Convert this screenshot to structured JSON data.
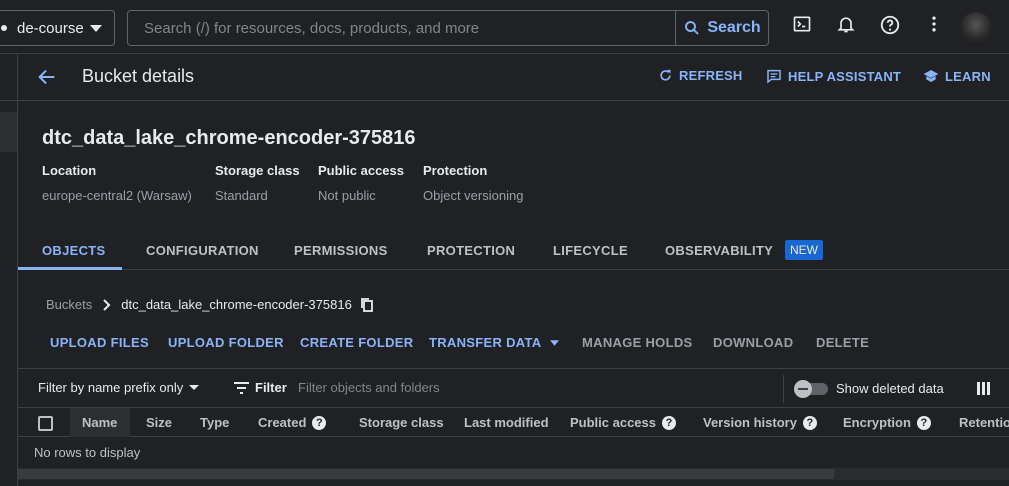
{
  "topbar": {
    "project_name": "de-course",
    "search_placeholder": "Search (/) for resources, docs, products, and more",
    "search_button": "Search",
    "icons": [
      "terminal-icon",
      "bell-icon",
      "help-icon",
      "more-vert-icon"
    ]
  },
  "header": {
    "title": "Bucket details",
    "refresh": "REFRESH",
    "help_assistant": "HELP ASSISTANT",
    "learn": "LEARN"
  },
  "bucket": {
    "name": "dtc_data_lake_chrome-encoder-375816",
    "meta": [
      {
        "key": "Location",
        "value": "europe-central2 (Warsaw)"
      },
      {
        "key": "Storage class",
        "value": "Standard"
      },
      {
        "key": "Public access",
        "value": "Not public"
      },
      {
        "key": "Protection",
        "value": "Object versioning"
      }
    ]
  },
  "tabs": [
    {
      "label": "OBJECTS",
      "active": true
    },
    {
      "label": "CONFIGURATION"
    },
    {
      "label": "PERMISSIONS"
    },
    {
      "label": "PROTECTION"
    },
    {
      "label": "LIFECYCLE"
    },
    {
      "label": "OBSERVABILITY"
    }
  ],
  "new_badge": "NEW",
  "breadcrumb": {
    "root": "Buckets",
    "current": "dtc_data_lake_chrome-encoder-375816"
  },
  "actions": {
    "upload_files": "UPLOAD FILES",
    "upload_folder": "UPLOAD FOLDER",
    "create_folder": "CREATE FOLDER",
    "transfer_data": "TRANSFER DATA",
    "manage_holds": "MANAGE HOLDS",
    "download": "DOWNLOAD",
    "delete": "DELETE"
  },
  "filter": {
    "prefix_select": "Filter by name prefix only",
    "label": "Filter",
    "placeholder": "Filter objects and folders",
    "show_deleted": "Show deleted data",
    "show_deleted_on": false
  },
  "table": {
    "columns": [
      "Name",
      "Size",
      "Type",
      "Created",
      "Storage class",
      "Last modified",
      "Public access",
      "Version history",
      "Encryption",
      "Retention"
    ],
    "empty_text": "No rows to display"
  },
  "colors": {
    "accent": "#8ab4f8",
    "background": "#202124",
    "badge": "#1967d2"
  }
}
